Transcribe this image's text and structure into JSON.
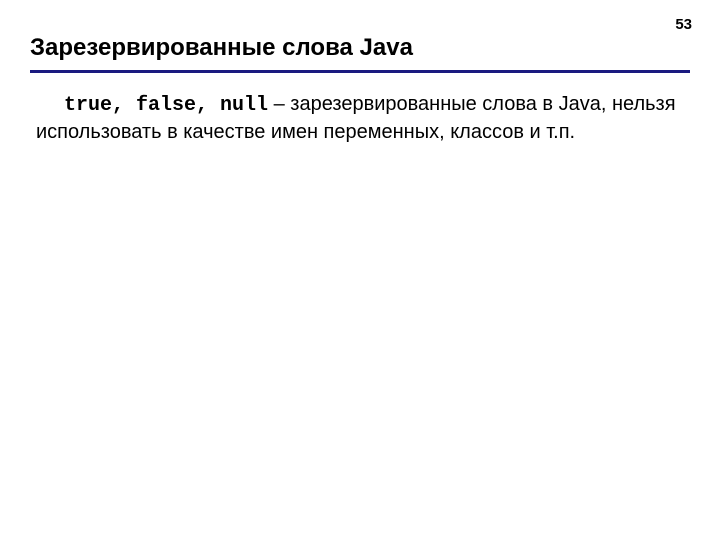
{
  "page_number": "53",
  "title": "Зарезервированные слова Java",
  "content": {
    "keywords": "true, false, null",
    "separator": " – ",
    "description": "зарезервированные слова в Java, нельзя использовать в качестве имен переменных, классов и т.п."
  }
}
